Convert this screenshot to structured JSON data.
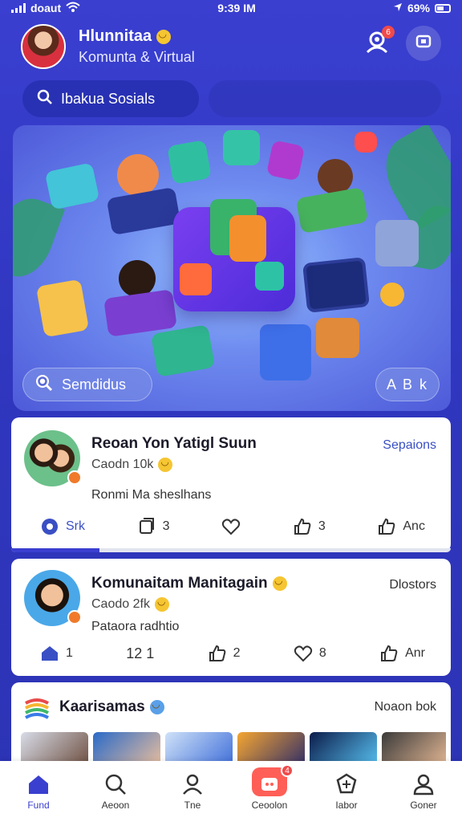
{
  "status_bar": {
    "carrier": "doaut",
    "time": "9:39 IM",
    "battery": "69%"
  },
  "header": {
    "title": "Hlunnitaa",
    "subtitle": "Komunta & Virtual",
    "notification_count": "6"
  },
  "search": {
    "placeholder": "Ibakua Sosials"
  },
  "hero": {
    "left_button": "Semdidus",
    "right_button": "A B k"
  },
  "posts": [
    {
      "title": "Reoan Yon Yatigl Suun",
      "meta": "Caodn 10k",
      "link": "Sepaions",
      "body": "Ronmi Ma sheslhans",
      "actions": [
        "Srk",
        "3",
        "",
        "3",
        "Anc"
      ],
      "progress": 0.2,
      "colors": {
        "link": "#3a4fc4"
      }
    },
    {
      "title": "Komunaitam Manitagain",
      "meta": "Caodo 2fk",
      "link": "Dlostors",
      "body": "Pataora radhtio",
      "actions": [
        "1",
        "12 1",
        "2",
        "8",
        "Anr"
      ]
    },
    {
      "title": "Kaarisamas",
      "link": "Noaon bok"
    }
  ],
  "bottom_nav": {
    "items": [
      {
        "label": "Fund",
        "icon": "home-icon"
      },
      {
        "label": "Aeoon",
        "icon": "search-icon"
      },
      {
        "label": "Tne",
        "icon": "person-icon"
      },
      {
        "label": "Ceoolon",
        "icon": "create-icon",
        "badge": "4"
      },
      {
        "label": "Iabor",
        "icon": "explore-icon"
      },
      {
        "label": "Goner",
        "icon": "profile-icon"
      }
    ]
  },
  "colors": {
    "accent": "#3a3fd0",
    "badge": "#f04a4a"
  }
}
